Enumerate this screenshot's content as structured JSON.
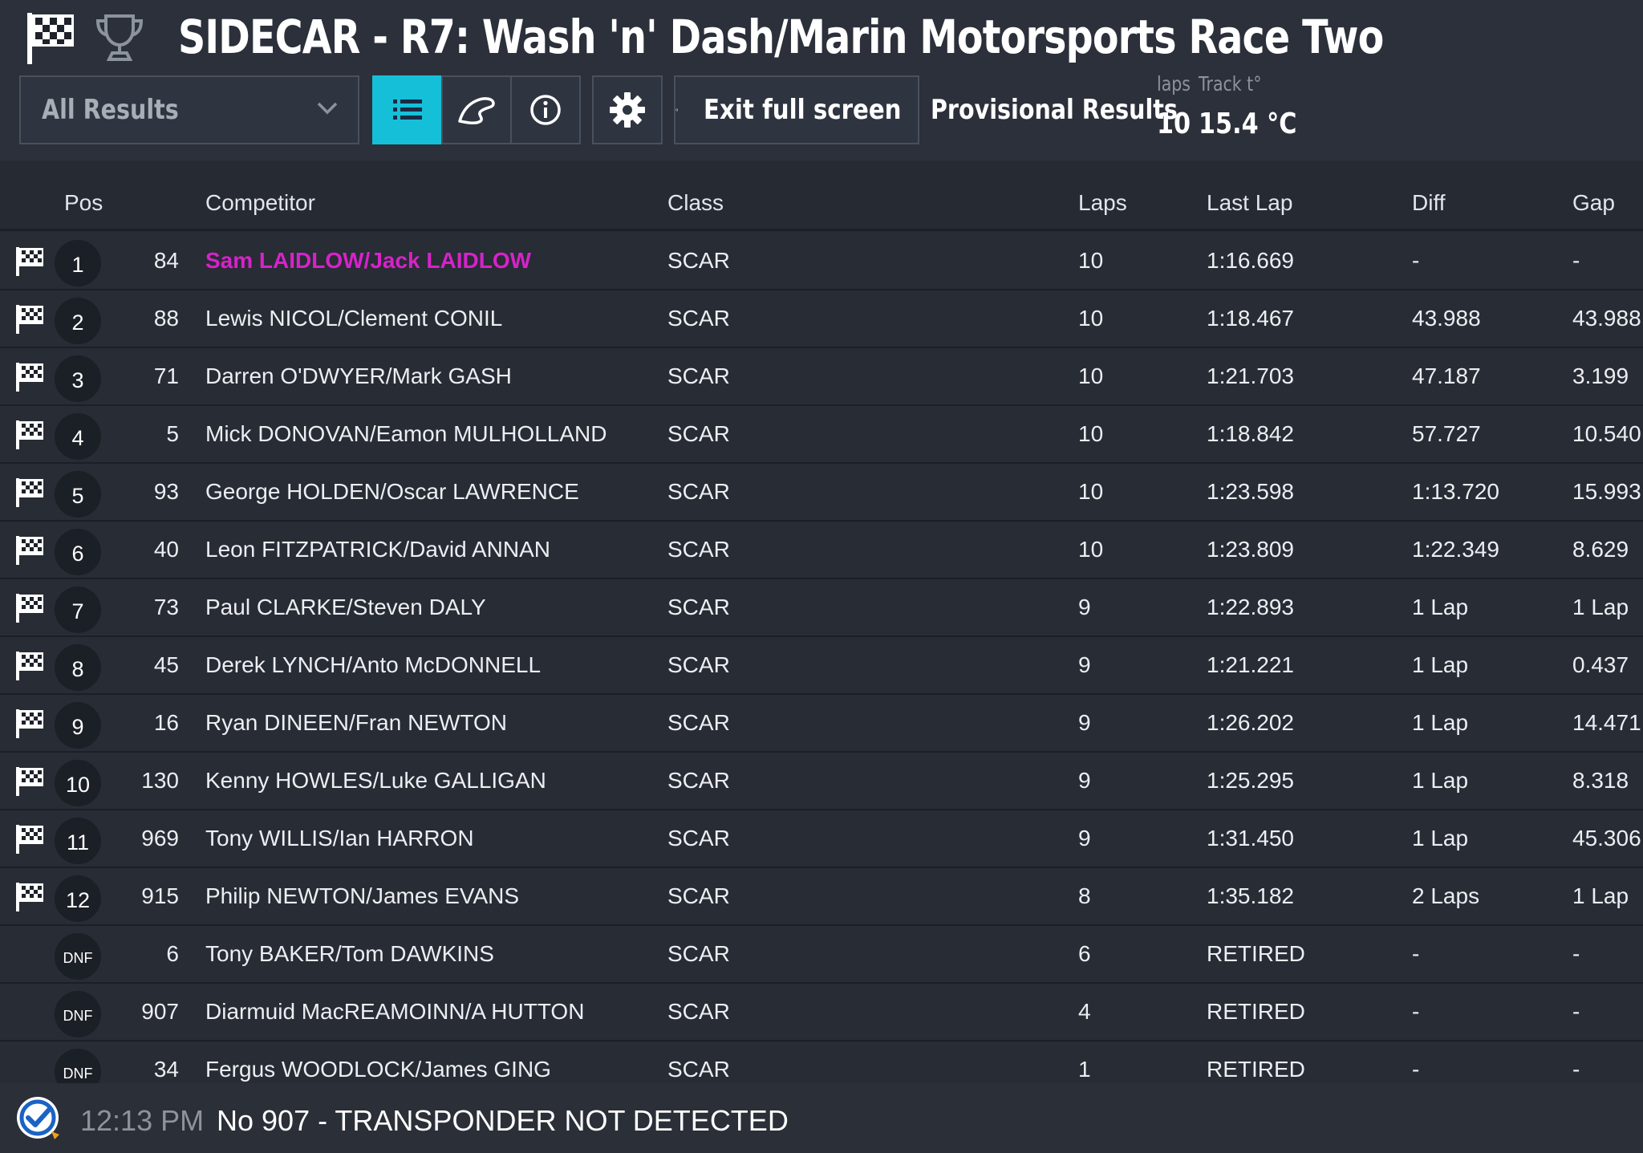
{
  "header": {
    "title": "SIDECAR - R7: Wash 'n' Dash/Marin Motorsports Race Two",
    "result_filter": "All Results",
    "exit_fullscreen_label": "Exit full screen",
    "status": "Provisional Results",
    "laps_label": "laps",
    "laps_value": "10",
    "track_temp_label": "Track t°",
    "track_temp_value": "15.4 °C"
  },
  "colors": {
    "accent": "#16bfd8",
    "leader_highlight": "#d722c9"
  },
  "columns": {
    "pos": "Pos",
    "competitor": "Competitor",
    "class": "Class",
    "laps": "Laps",
    "last_lap": "Last Lap",
    "diff": "Diff",
    "gap": "Gap"
  },
  "rows": [
    {
      "pos": "1",
      "num": "84",
      "competitor": "Sam LAIDLOW/Jack LAIDLOW",
      "class": "SCAR",
      "laps": "10",
      "last_lap": "1:16.669",
      "diff": "-",
      "gap": "-",
      "flag": true,
      "highlight": true
    },
    {
      "pos": "2",
      "num": "88",
      "competitor": "Lewis NICOL/Clement CONIL",
      "class": "SCAR",
      "laps": "10",
      "last_lap": "1:18.467",
      "diff": "43.988",
      "gap": "43.988",
      "flag": true
    },
    {
      "pos": "3",
      "num": "71",
      "competitor": "Darren O'DWYER/Mark GASH",
      "class": "SCAR",
      "laps": "10",
      "last_lap": "1:21.703",
      "diff": "47.187",
      "gap": "3.199",
      "flag": true
    },
    {
      "pos": "4",
      "num": "5",
      "competitor": "Mick DONOVAN/Eamon MULHOLLAND",
      "class": "SCAR",
      "laps": "10",
      "last_lap": "1:18.842",
      "diff": "57.727",
      "gap": "10.540",
      "flag": true
    },
    {
      "pos": "5",
      "num": "93",
      "competitor": "George HOLDEN/Oscar LAWRENCE",
      "class": "SCAR",
      "laps": "10",
      "last_lap": "1:23.598",
      "diff": "1:13.720",
      "gap": "15.993",
      "flag": true
    },
    {
      "pos": "6",
      "num": "40",
      "competitor": "Leon FITZPATRICK/David ANNAN",
      "class": "SCAR",
      "laps": "10",
      "last_lap": "1:23.809",
      "diff": "1:22.349",
      "gap": "8.629",
      "flag": true
    },
    {
      "pos": "7",
      "num": "73",
      "competitor": "Paul CLARKE/Steven DALY",
      "class": "SCAR",
      "laps": "9",
      "last_lap": "1:22.893",
      "diff": "1 Lap",
      "gap": "1 Lap",
      "flag": true
    },
    {
      "pos": "8",
      "num": "45",
      "competitor": "Derek LYNCH/Anto McDONNELL",
      "class": "SCAR",
      "laps": "9",
      "last_lap": "1:21.221",
      "diff": "1 Lap",
      "gap": "0.437",
      "flag": true
    },
    {
      "pos": "9",
      "num": "16",
      "competitor": "Ryan DINEEN/Fran NEWTON",
      "class": "SCAR",
      "laps": "9",
      "last_lap": "1:26.202",
      "diff": "1 Lap",
      "gap": "14.471",
      "flag": true
    },
    {
      "pos": "10",
      "num": "130",
      "competitor": "Kenny HOWLES/Luke GALLIGAN",
      "class": "SCAR",
      "laps": "9",
      "last_lap": "1:25.295",
      "diff": "1 Lap",
      "gap": "8.318",
      "flag": true
    },
    {
      "pos": "11",
      "num": "969",
      "competitor": "Tony WILLIS/Ian HARRON",
      "class": "SCAR",
      "laps": "9",
      "last_lap": "1:31.450",
      "diff": "1 Lap",
      "gap": "45.306",
      "flag": true
    },
    {
      "pos": "12",
      "num": "915",
      "competitor": "Philip NEWTON/James EVANS",
      "class": "SCAR",
      "laps": "8",
      "last_lap": "1:35.182",
      "diff": "2 Laps",
      "gap": "1 Lap",
      "flag": true
    },
    {
      "pos": "DNF",
      "num": "6",
      "competitor": "Tony BAKER/Tom DAWKINS",
      "class": "SCAR",
      "laps": "6",
      "last_lap": "RETIRED",
      "diff": "-",
      "gap": "-",
      "flag": false
    },
    {
      "pos": "DNF",
      "num": "907",
      "competitor": "Diarmuid MacREAMOINN/A HUTTON",
      "class": "SCAR",
      "laps": "4",
      "last_lap": "RETIRED",
      "diff": "-",
      "gap": "-",
      "flag": false
    },
    {
      "pos": "DNF",
      "num": "34",
      "competitor": "Fergus WOODLOCK/James GING",
      "class": "SCAR",
      "laps": "1",
      "last_lap": "RETIRED",
      "diff": "-",
      "gap": "-",
      "flag": false
    }
  ],
  "footer": {
    "time": "12:13 PM",
    "message": "No 907 - TRANSPONDER NOT DETECTED"
  }
}
